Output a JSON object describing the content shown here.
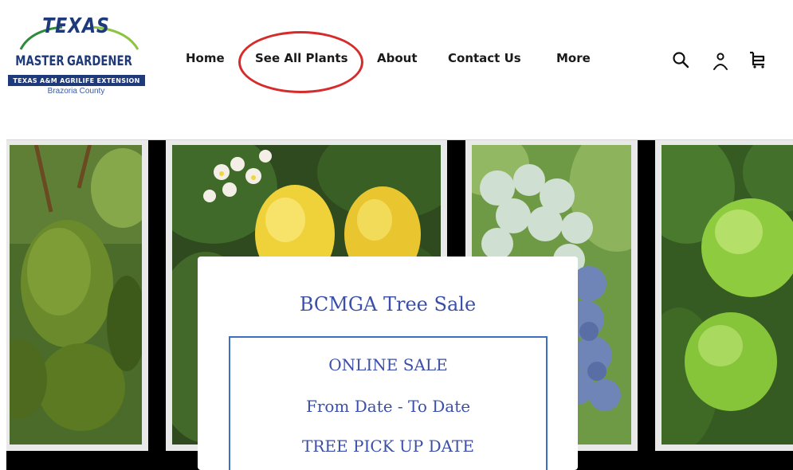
{
  "logo": {
    "title": "TEXAS",
    "name_left": "MASTER",
    "name_right": "GARDENER",
    "extension": "TEXAS A&M AGRILIFE EXTENSION",
    "county": "Brazoria County"
  },
  "nav": {
    "items": [
      {
        "label": "Home"
      },
      {
        "label": "See All Plants"
      },
      {
        "label": "About"
      },
      {
        "label": "Contact Us"
      },
      {
        "label": "More"
      }
    ]
  },
  "icons": [
    "search-icon",
    "account-icon",
    "cart-icon"
  ],
  "colors": {
    "brand_blue": "#1f3a7a",
    "card_text": "#3b4fa8",
    "card_border": "#3b6fc2",
    "highlight": "#d62b2b"
  },
  "hero": {
    "panels": [
      "avocado-photo",
      "lemon-photo",
      "blueberry-photo",
      "lime-photo"
    ]
  },
  "card": {
    "title": "BCMGA Tree Sale",
    "lines": [
      "ONLINE SALE",
      "From Date - To Date",
      "TREE PICK UP DATE"
    ]
  }
}
